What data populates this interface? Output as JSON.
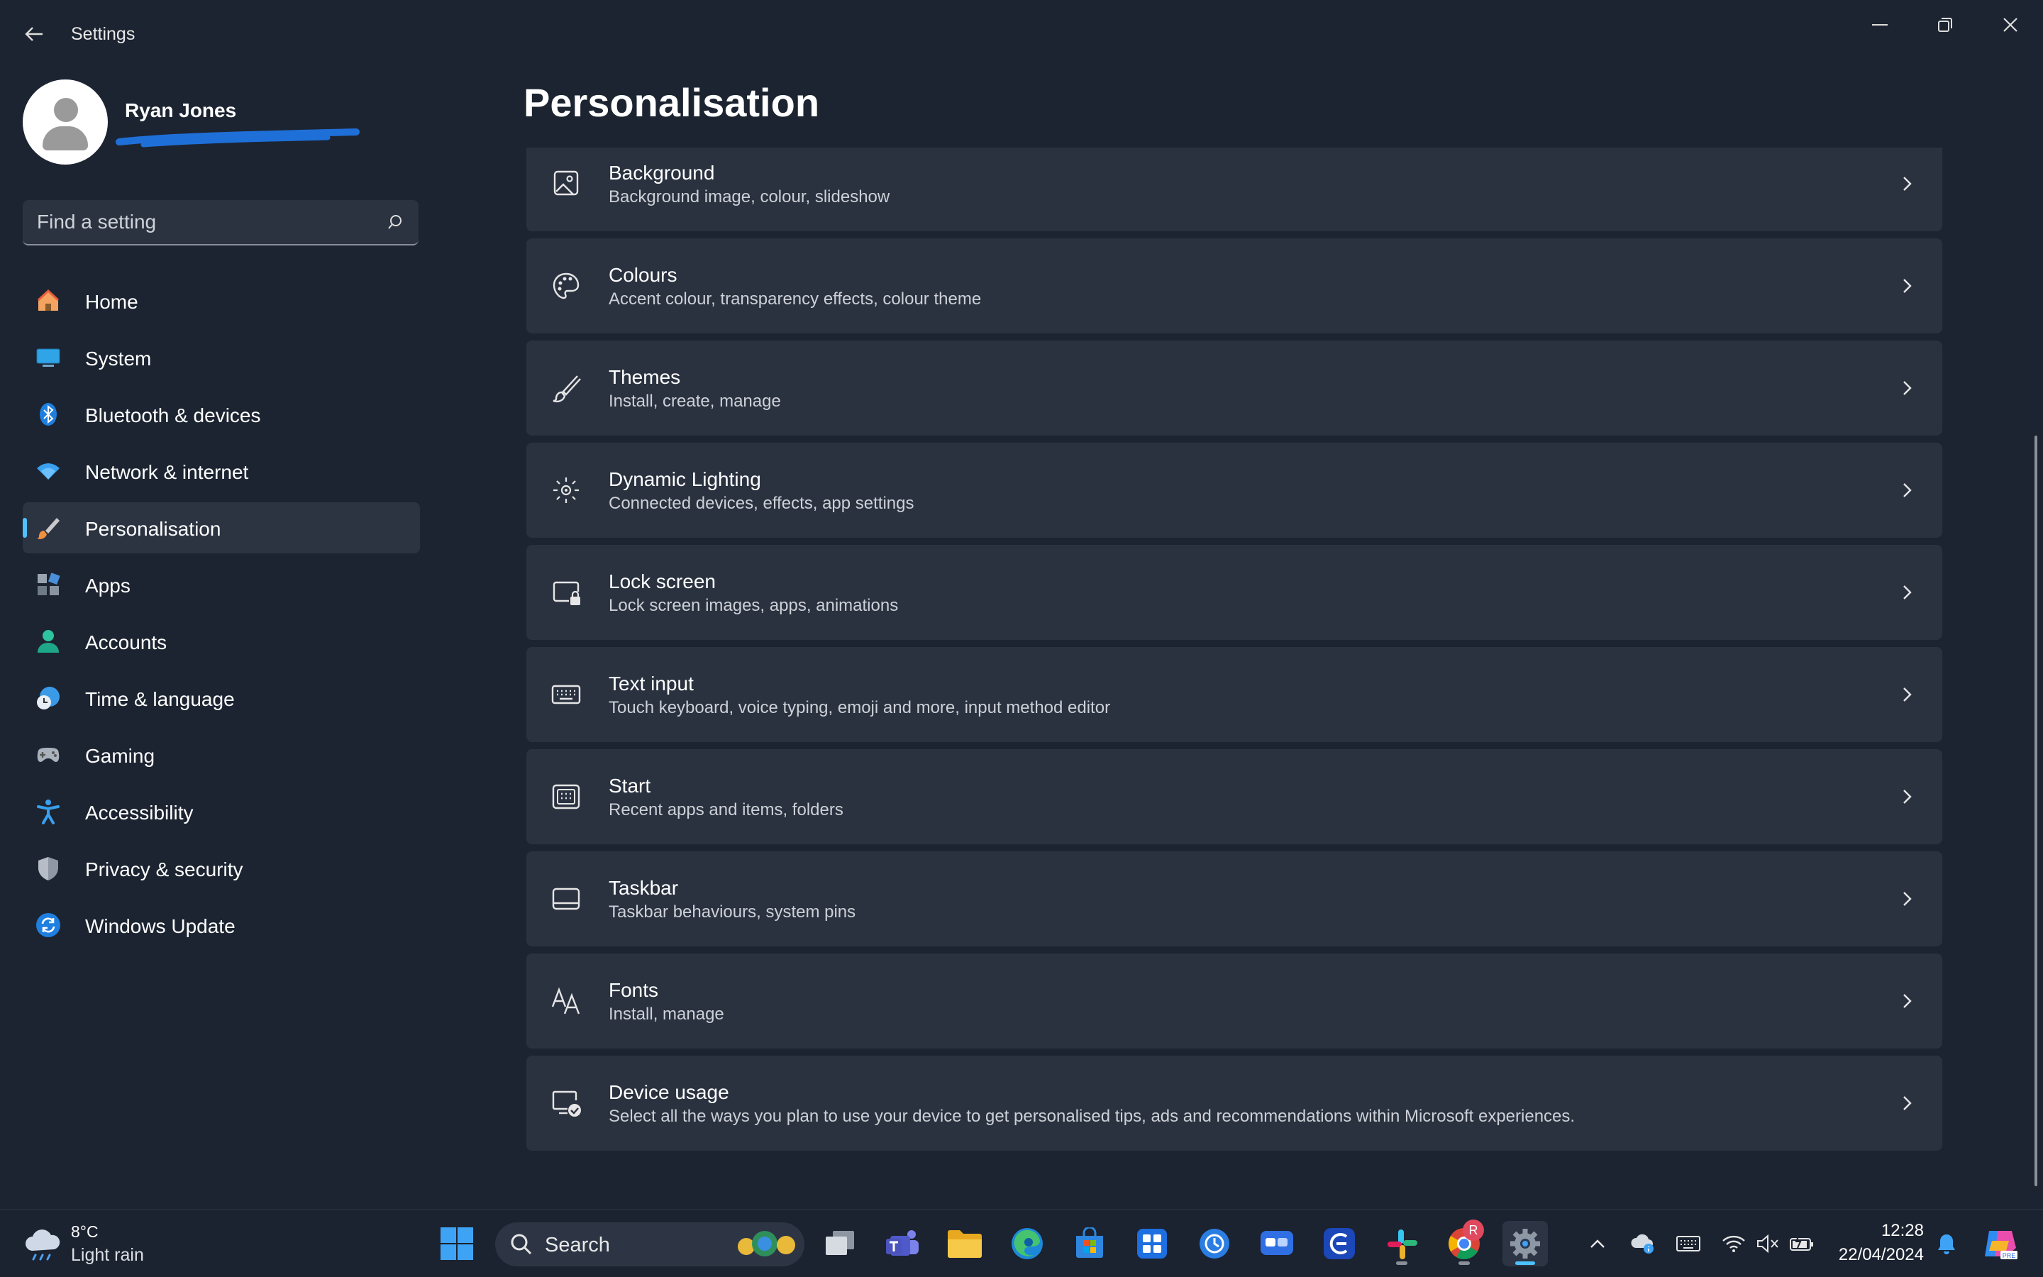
{
  "window": {
    "title": "Settings"
  },
  "profile": {
    "name": "Ryan Jones"
  },
  "search": {
    "placeholder": "Find a setting"
  },
  "sidebar": {
    "items": [
      {
        "label": "Home",
        "icon": "home-icon"
      },
      {
        "label": "System",
        "icon": "system-icon"
      },
      {
        "label": "Bluetooth & devices",
        "icon": "bluetooth-icon"
      },
      {
        "label": "Network & internet",
        "icon": "wifi-icon"
      },
      {
        "label": "Personalisation",
        "icon": "brush-icon",
        "active": true
      },
      {
        "label": "Apps",
        "icon": "apps-icon"
      },
      {
        "label": "Accounts",
        "icon": "accounts-icon"
      },
      {
        "label": "Time & language",
        "icon": "clock-globe-icon"
      },
      {
        "label": "Gaming",
        "icon": "gamepad-icon"
      },
      {
        "label": "Accessibility",
        "icon": "accessibility-icon"
      },
      {
        "label": "Privacy & security",
        "icon": "shield-icon"
      },
      {
        "label": "Windows Update",
        "icon": "update-icon"
      }
    ]
  },
  "main": {
    "title": "Personalisation",
    "cards": [
      {
        "title": "Background",
        "subtitle": "Background image, colour, slideshow",
        "icon": "image-icon"
      },
      {
        "title": "Colours",
        "subtitle": "Accent colour, transparency effects, colour theme",
        "icon": "palette-icon"
      },
      {
        "title": "Themes",
        "subtitle": "Install, create, manage",
        "icon": "brush-icon"
      },
      {
        "title": "Dynamic Lighting",
        "subtitle": "Connected devices, effects, app settings",
        "icon": "lighting-icon"
      },
      {
        "title": "Lock screen",
        "subtitle": "Lock screen images, apps, animations",
        "icon": "lock-screen-icon"
      },
      {
        "title": "Text input",
        "subtitle": "Touch keyboard, voice typing, emoji and more, input method editor",
        "icon": "keyboard-icon"
      },
      {
        "title": "Start",
        "subtitle": "Recent apps and items, folders",
        "icon": "start-icon"
      },
      {
        "title": "Taskbar",
        "subtitle": "Taskbar behaviours, system pins",
        "icon": "taskbar-icon"
      },
      {
        "title": "Fonts",
        "subtitle": "Install, manage",
        "icon": "fonts-icon"
      },
      {
        "title": "Device usage",
        "subtitle": "Select all the ways you plan to use your device to get personalised tips, ads and recommendations within Microsoft experiences.",
        "icon": "device-usage-icon"
      }
    ]
  },
  "taskbar": {
    "weather": {
      "temp": "8°C",
      "condition": "Light rain"
    },
    "search_label": "Search",
    "clock": {
      "time": "12:28",
      "date": "22/04/2024"
    },
    "chrome_badge": "R"
  },
  "colors": {
    "accent": "#4cc2ff",
    "background": "#1c2431",
    "card": "#2a3240"
  }
}
